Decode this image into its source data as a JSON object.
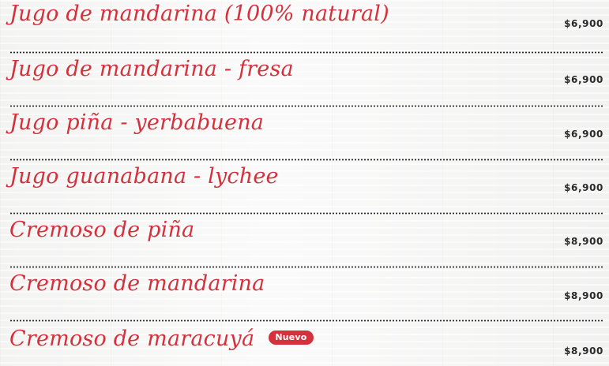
{
  "menu": {
    "items": [
      {
        "name": "Jugo de mandarina (100% natural)",
        "price": "$6,900"
      },
      {
        "name": "Jugo de mandarina - fresa",
        "price": "$6,900"
      },
      {
        "name": "Jugo piña - yerbabuena",
        "price": "$6,900"
      },
      {
        "name": "Jugo guanabana - lychee",
        "price": "$6,900"
      },
      {
        "name": "Cremoso de piña",
        "price": "$8,900"
      },
      {
        "name": "Cremoso de mandarina",
        "price": "$8,900"
      },
      {
        "name": "Cremoso de maracuyá",
        "price": "$8,900",
        "badge": "Nuevo"
      }
    ]
  },
  "colors": {
    "item_name": "#d3323c",
    "price": "#2a2a2a",
    "badge_background": "#d3323c",
    "divider": "#2b2b2b"
  }
}
